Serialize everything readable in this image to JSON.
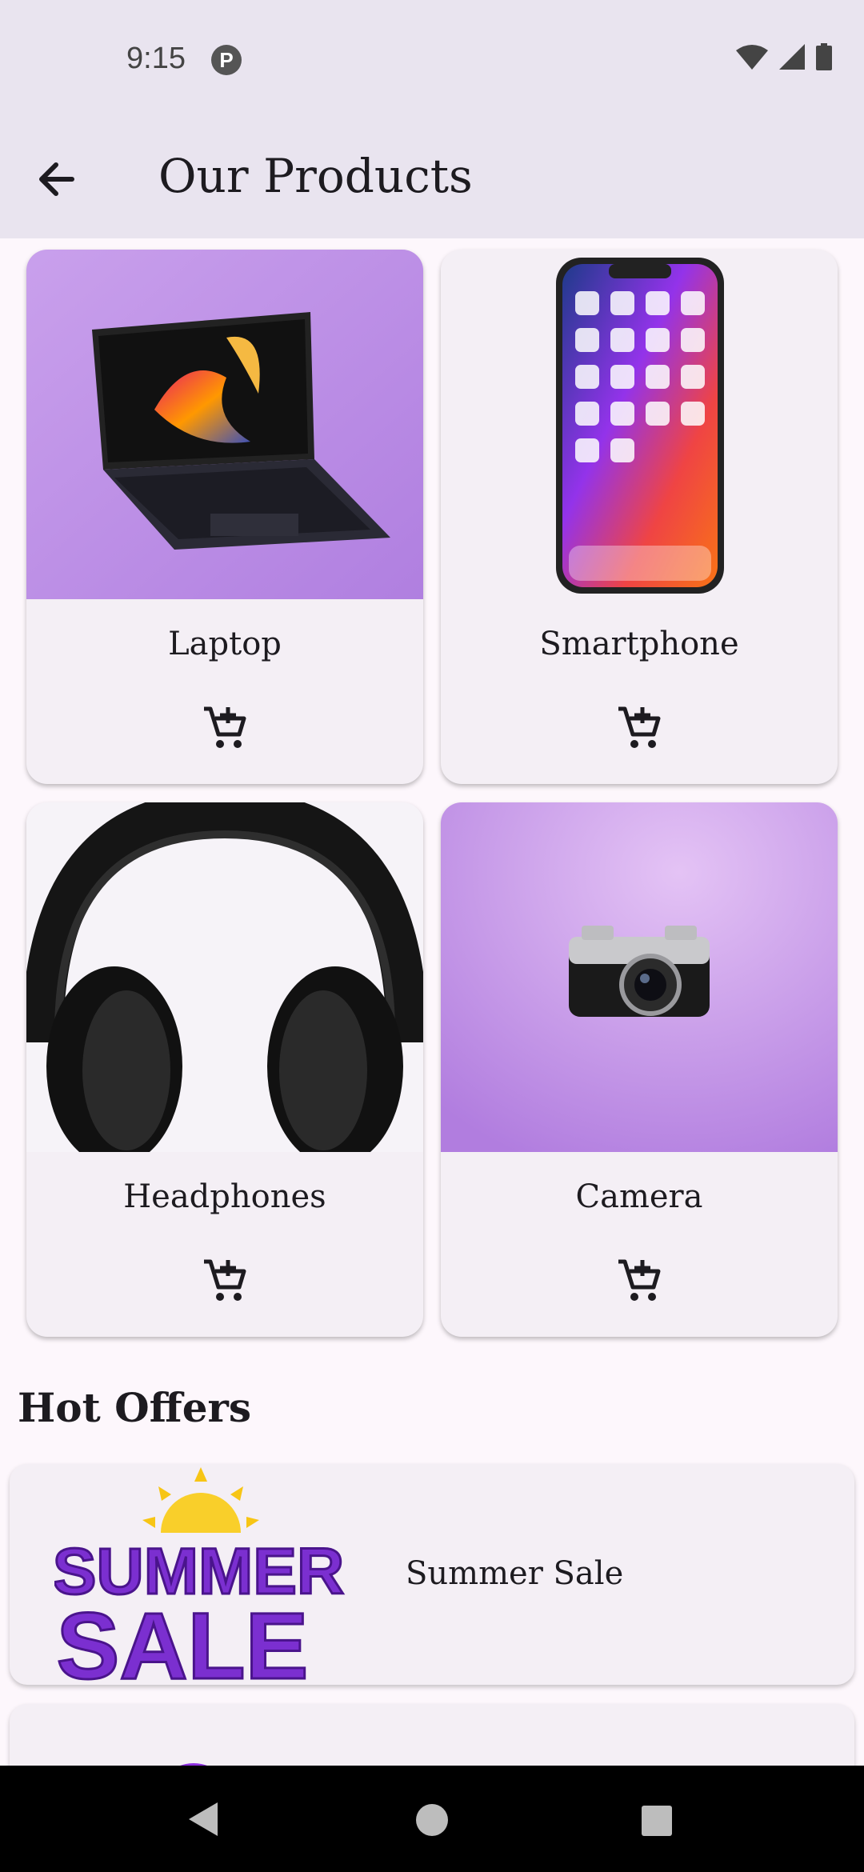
{
  "status": {
    "time": "9:15",
    "app_icon_letter": "P"
  },
  "appbar": {
    "title": "Our Products"
  },
  "products": [
    {
      "name": "Laptop"
    },
    {
      "name": "Smartphone"
    },
    {
      "name": "Headphones"
    },
    {
      "name": "Camera"
    }
  ],
  "section": {
    "title": "Hot Offers"
  },
  "offers": [
    {
      "label": "Summer Sale",
      "graphic_line1": "SUMMER",
      "graphic_line2": "SALE"
    }
  ],
  "colors": {
    "accent": "#7b2fd0",
    "bar": "#e9e4ef",
    "card": "#f4eff5"
  }
}
